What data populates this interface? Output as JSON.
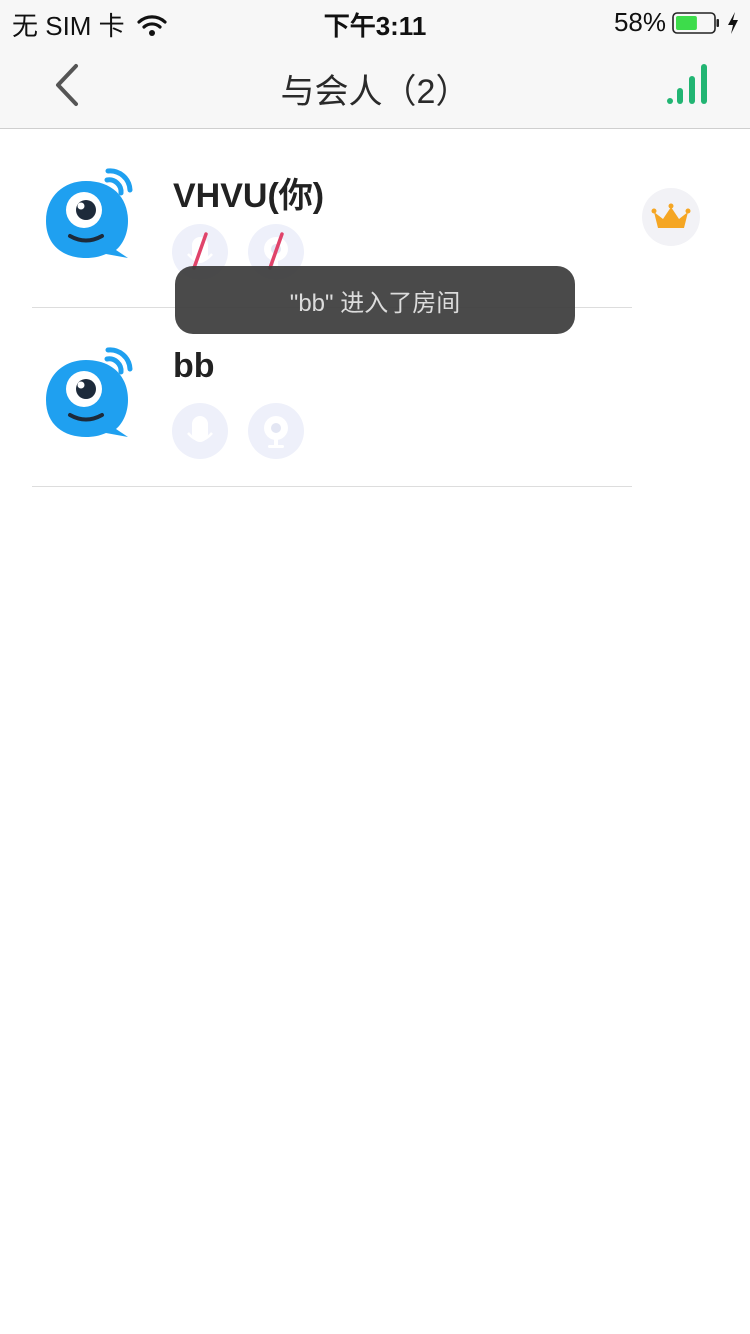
{
  "status_bar": {
    "carrier": "无 SIM 卡",
    "time": "下午3:11",
    "battery_percent": "58%",
    "battery_level": 0.58
  },
  "nav": {
    "title": "与会人（2）",
    "back_icon": "chevron-left-icon",
    "right_icon": "signal-bars-icon",
    "accent_color": "#22b573"
  },
  "participants": [
    {
      "name": "VHVU(你)",
      "avatar_icon": "blue-bubble-avatar-icon",
      "mic_muted": true,
      "camera_off": true,
      "is_host": true,
      "host_icon": "crown-icon"
    },
    {
      "name": "bb",
      "avatar_icon": "blue-bubble-avatar-icon",
      "mic_muted": false,
      "camera_off": false,
      "is_host": false
    }
  ],
  "toast": {
    "text": "\"bb\" 进入了房间"
  },
  "colors": {
    "avatar_blue": "#1fa0f0",
    "muted_slash": "#e0436a",
    "crown": "#f5a623"
  }
}
